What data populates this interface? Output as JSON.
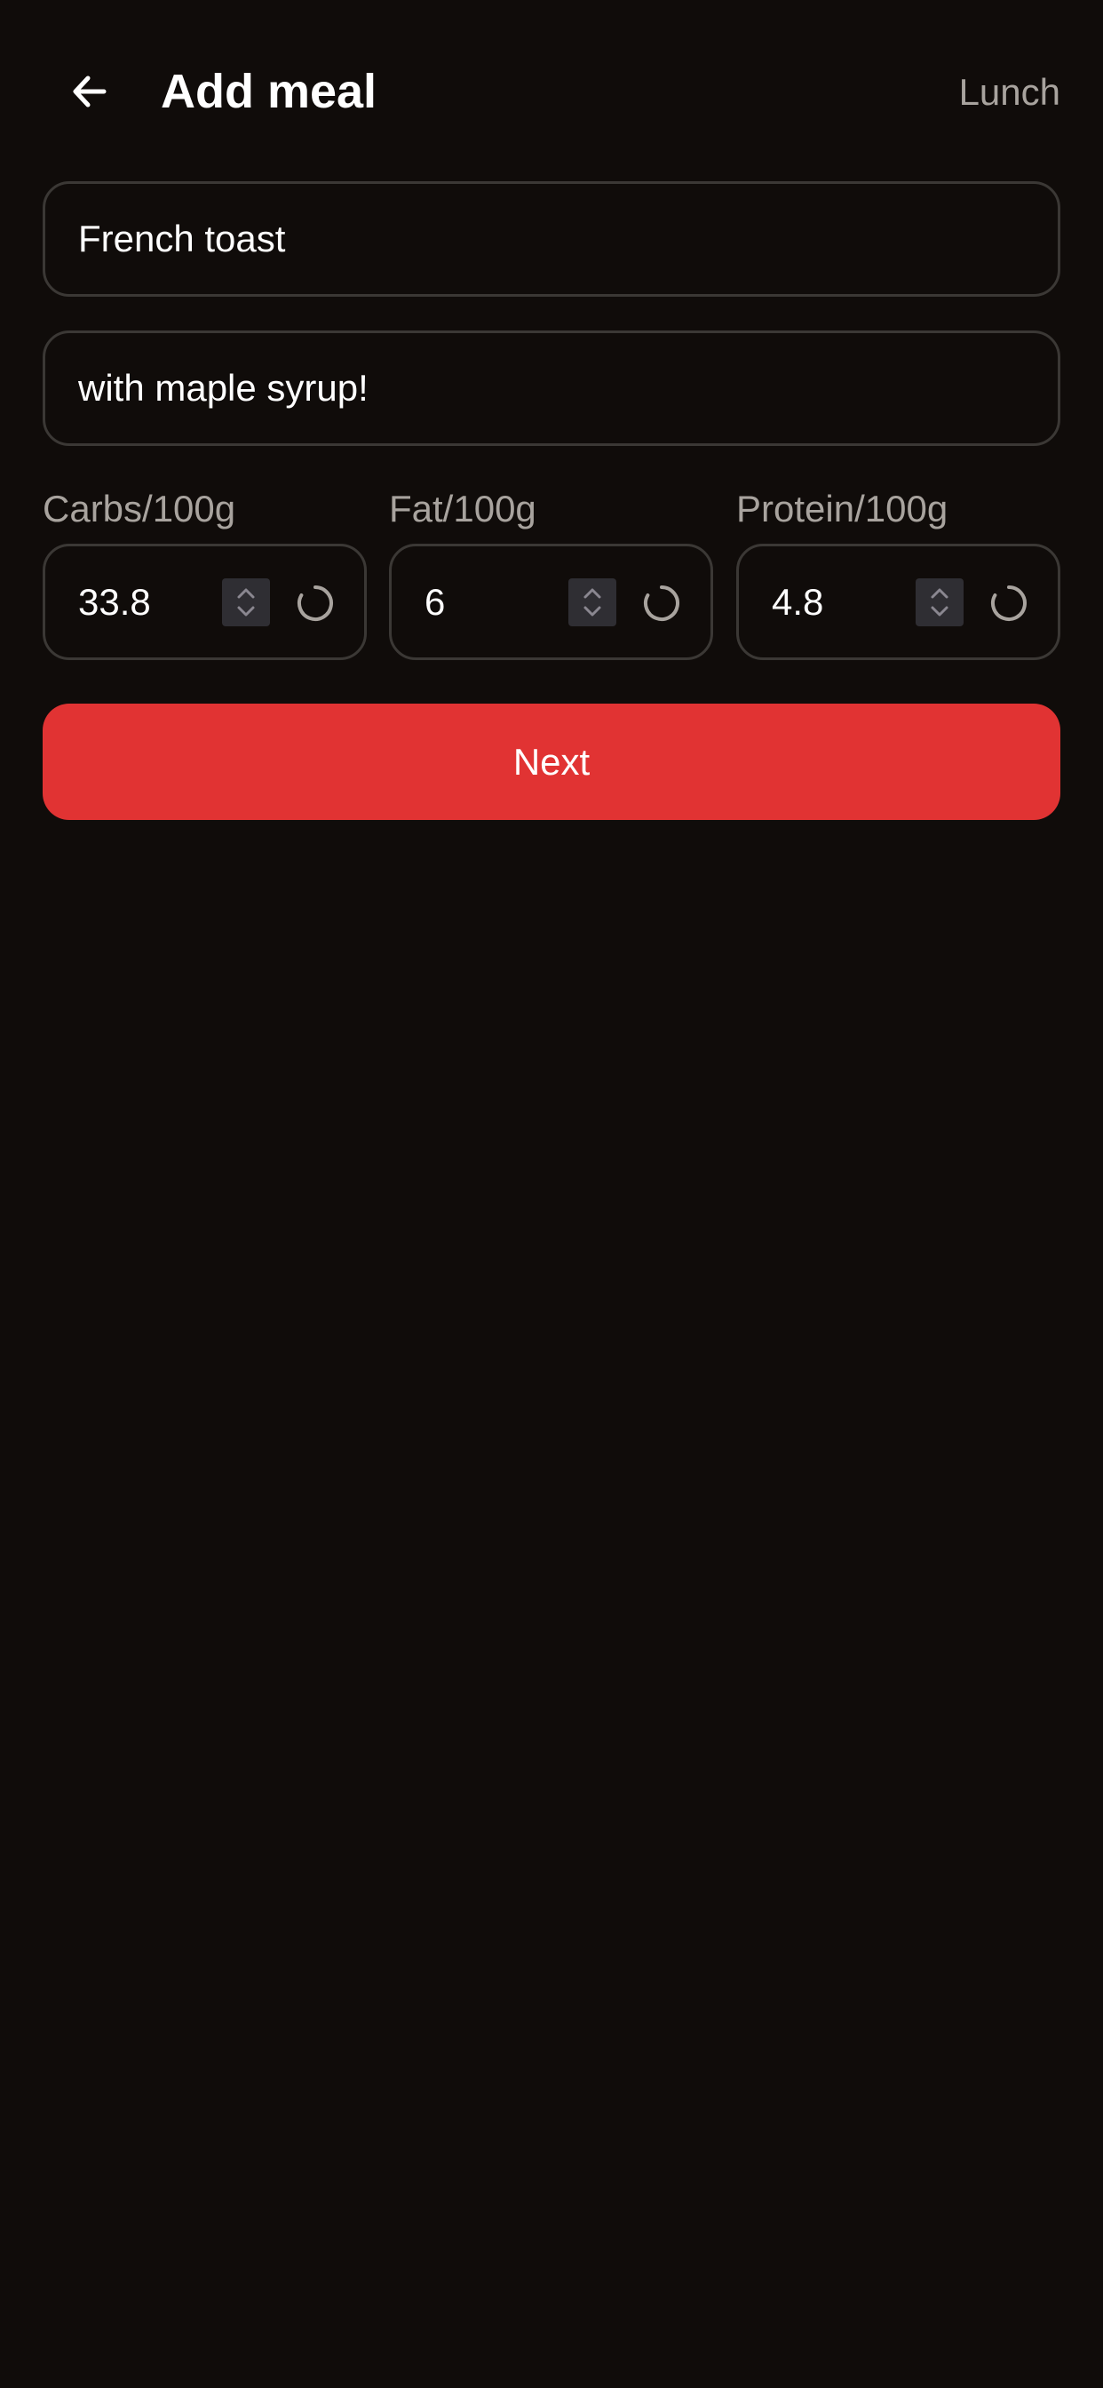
{
  "header": {
    "title": "Add meal",
    "meal_type": "Lunch",
    "back_icon": "arrow-left-icon"
  },
  "form": {
    "name_value": "French toast",
    "description_value": "with maple syrup!",
    "macros": [
      {
        "label": "Carbs/100g",
        "value": "33.8"
      },
      {
        "label": "Fat/100g",
        "value": "6"
      },
      {
        "label": "Protein/100g",
        "value": "4.8"
      }
    ],
    "stepper_icon": "chevron-up-down-icon",
    "spinner_icon": "loading-spinner-icon"
  },
  "actions": {
    "next_label": "Next"
  },
  "colors": {
    "background": "#100c0a",
    "text": "#ffffff",
    "muted_text": "#a8a39e",
    "field_border": "#3b3835",
    "stepper_bg": "#2f2e33",
    "accent": "#e13333"
  }
}
